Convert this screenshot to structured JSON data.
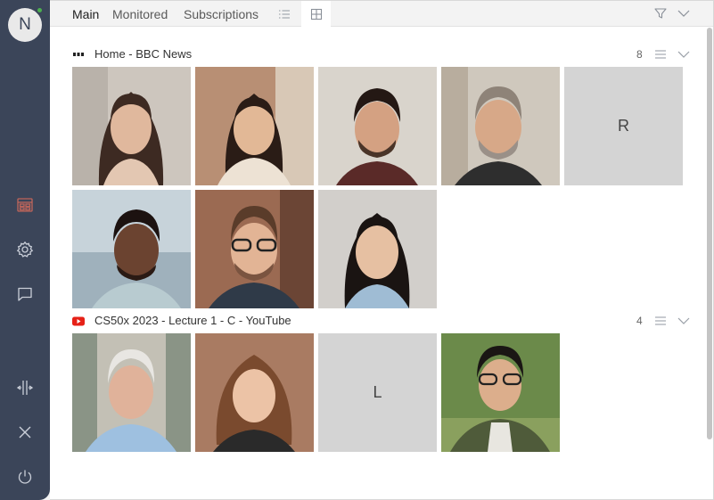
{
  "user": {
    "initial": "N",
    "status": "online"
  },
  "sidebar": {
    "items": [
      {
        "icon": "tiles-icon",
        "active": true
      },
      {
        "icon": "gear-icon"
      },
      {
        "icon": "chat-bubble-icon"
      },
      {
        "icon": "split-view-icon"
      },
      {
        "icon": "close-icon"
      },
      {
        "icon": "power-icon"
      }
    ]
  },
  "tabs": [
    {
      "label": "Main",
      "active": true
    },
    {
      "label": "Monitored"
    },
    {
      "label": "Subscriptions"
    }
  ],
  "view_modes": [
    "list-view-icon",
    "grid-view-icon"
  ],
  "selected_view": "grid-view-icon",
  "groups": [
    {
      "title": "Home - BBC News",
      "count": "8",
      "favicon": "bbc-news-icon",
      "tiles": [
        {
          "kind": "photo",
          "person": "woman-long-dark-hair"
        },
        {
          "kind": "photo",
          "person": "woman-shoulder-hair"
        },
        {
          "kind": "photo",
          "person": "man-short-dark-hair"
        },
        {
          "kind": "photo",
          "person": "man-grey-beard"
        },
        {
          "kind": "letter",
          "letter": "R"
        },
        {
          "kind": "photo",
          "person": "man-smiling-beard"
        },
        {
          "kind": "photo",
          "person": "man-glasses"
        },
        {
          "kind": "photo",
          "person": "woman-smiling"
        }
      ]
    },
    {
      "title": "CS50x 2023 - Lecture 1 - C - YouTube",
      "count": "4",
      "favicon": "youtube-icon",
      "tiles": [
        {
          "kind": "photo",
          "person": "older-man-white-hair"
        },
        {
          "kind": "photo",
          "person": "woman-wavy-hair"
        },
        {
          "kind": "letter",
          "letter": "L"
        },
        {
          "kind": "photo",
          "person": "man-glasses-park"
        }
      ]
    }
  ],
  "colors": {
    "sidebar": "#3b4559",
    "active_sidebar_icon": "#c0655a",
    "online": "#4caf50",
    "youtube": "#e62117",
    "letter_tile_bg": "#d4d4d4"
  }
}
